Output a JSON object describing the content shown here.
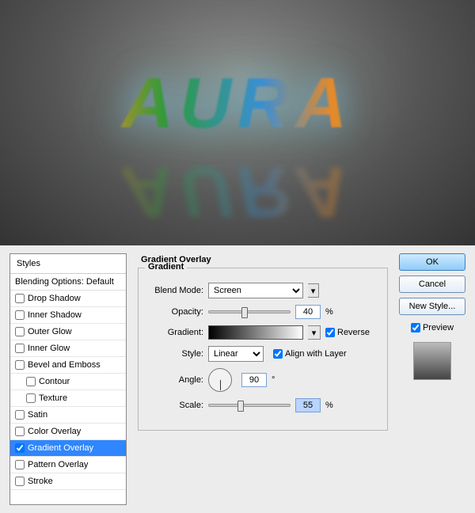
{
  "preview": {
    "text": "AURA"
  },
  "styles": {
    "header": "Styles",
    "blending_options": "Blending Options: Default",
    "items": [
      {
        "label": "Drop Shadow",
        "checked": false,
        "selected": false,
        "indent": false
      },
      {
        "label": "Inner Shadow",
        "checked": false,
        "selected": false,
        "indent": false
      },
      {
        "label": "Outer Glow",
        "checked": false,
        "selected": false,
        "indent": false
      },
      {
        "label": "Inner Glow",
        "checked": false,
        "selected": false,
        "indent": false
      },
      {
        "label": "Bevel and Emboss",
        "checked": false,
        "selected": false,
        "indent": false
      },
      {
        "label": "Contour",
        "checked": false,
        "selected": false,
        "indent": true
      },
      {
        "label": "Texture",
        "checked": false,
        "selected": false,
        "indent": true
      },
      {
        "label": "Satin",
        "checked": false,
        "selected": false,
        "indent": false
      },
      {
        "label": "Color Overlay",
        "checked": false,
        "selected": false,
        "indent": false
      },
      {
        "label": "Gradient Overlay",
        "checked": true,
        "selected": true,
        "indent": false
      },
      {
        "label": "Pattern Overlay",
        "checked": false,
        "selected": false,
        "indent": false
      },
      {
        "label": "Stroke",
        "checked": false,
        "selected": false,
        "indent": false
      }
    ]
  },
  "center": {
    "title": "Gradient Overlay",
    "legend": "Gradient",
    "labels": {
      "blend_mode": "Blend Mode:",
      "opacity": "Opacity:",
      "gradient": "Gradient:",
      "style": "Style:",
      "angle": "Angle:",
      "scale": "Scale:"
    },
    "blend_mode": "Screen",
    "opacity": {
      "value": "40",
      "unit": "%",
      "thumb_pct": 40
    },
    "gradient": {
      "reverse_label": "Reverse",
      "reverse": true
    },
    "style": {
      "value": "Linear",
      "align_label": "Align with Layer",
      "align": true
    },
    "angle": {
      "value": "90",
      "unit": "°"
    },
    "scale": {
      "value": "55",
      "unit": "%",
      "thumb_pct": 35
    }
  },
  "right": {
    "ok": "OK",
    "cancel": "Cancel",
    "new_style": "New Style...",
    "preview_label": "Preview",
    "preview_checked": true
  },
  "watermark": ""
}
